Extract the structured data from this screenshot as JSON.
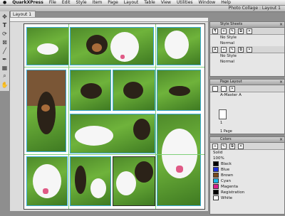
{
  "menubar": {
    "apple_icon": "apple-icon",
    "items": [
      "QuarkXPress",
      "File",
      "Edit",
      "Style",
      "Item",
      "Page",
      "Layout",
      "Table",
      "View",
      "Utilities",
      "Window",
      "Help"
    ]
  },
  "window": {
    "title": "Photo Collage : Layout 1",
    "tab": "Layout 1"
  },
  "tools": [
    "move-icon",
    "text-icon",
    "rotate-icon",
    "picture-box-icon",
    "line-icon",
    "pen-icon",
    "table-icon",
    "zoom-icon",
    "hand-icon"
  ],
  "panels": {
    "style_sheets": {
      "title": "Style Sheets",
      "paragraph_items": [
        "No Style",
        "Normal"
      ],
      "character_items": [
        "No Style",
        "Normal"
      ]
    },
    "page_layout": {
      "title": "Page Layout",
      "master": "A-Master A",
      "page_number": "1",
      "footer": "1 Page"
    },
    "colors": {
      "title": "Colors",
      "mode": "Solid",
      "shade": "100%",
      "items": [
        {
          "name": "Black",
          "color": "#000000"
        },
        {
          "name": "Blue",
          "color": "#1c2fd6"
        },
        {
          "name": "Brown",
          "color": "#7a4a1c"
        },
        {
          "name": "Cyan",
          "color": "#19b5e8"
        },
        {
          "name": "Magenta",
          "color": "#d81e8c"
        },
        {
          "name": "Registration",
          "color": "#000000"
        },
        {
          "name": "White",
          "color": "#ffffff"
        }
      ]
    }
  },
  "accent": "#3aa9d8"
}
